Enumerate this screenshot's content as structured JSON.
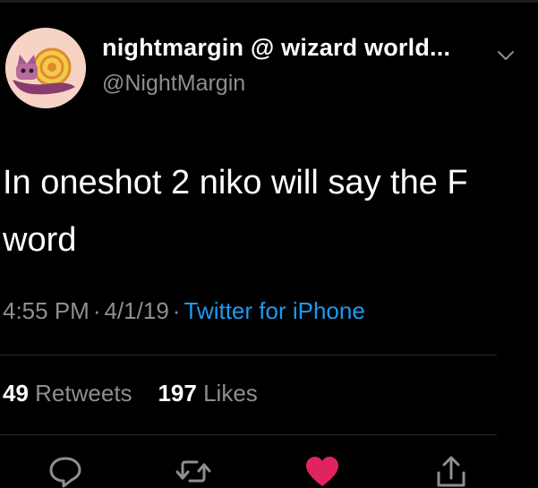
{
  "tweet": {
    "display_name": "nightmargin @ wizard world...",
    "handle": "@NightMargin",
    "text": "In oneshot 2 niko will say the F word",
    "time": "4:55 PM",
    "date": "4/1/19",
    "source": "Twitter for iPhone",
    "separator": "·"
  },
  "stats": {
    "retweets_count": "49",
    "retweets_label": "Retweets",
    "likes_count": "197",
    "likes_label": "Likes"
  },
  "actions": {
    "reply_icon": "reply-icon",
    "retweet_icon": "retweet-icon",
    "like_icon": "heart-icon",
    "share_icon": "share-icon"
  },
  "colors": {
    "background": "#000000",
    "primary_text": "#ffffff",
    "secondary_text": "#8e8e93",
    "link": "#1d9bf0",
    "like": "#e0245e",
    "divider": "#2c2c2e"
  }
}
